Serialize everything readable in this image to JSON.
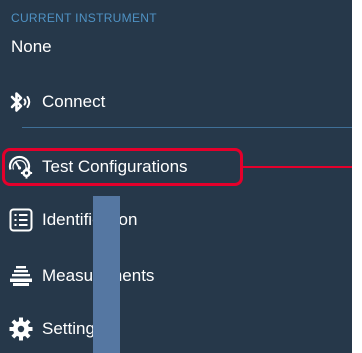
{
  "instrument": {
    "caption": "CURRENT INSTRUMENT",
    "value": "None"
  },
  "menu": {
    "connect": {
      "label": "Connect",
      "icon": "bluetooth-icon"
    },
    "test_configurations": {
      "label": "Test Configurations",
      "icon": "gauge-gear-icon",
      "highlighted": true
    },
    "identification": {
      "label": "Identification",
      "icon": "list-icon"
    },
    "measurements": {
      "label": "Measurements",
      "icon": "scale-icon"
    },
    "settings": {
      "label": "Settings",
      "icon": "gear-icon"
    }
  },
  "colors": {
    "sidebar_background": "#26384a",
    "caption_text": "#4f92c4",
    "highlight": "#e4002b",
    "occluder": "#5577a2"
  }
}
